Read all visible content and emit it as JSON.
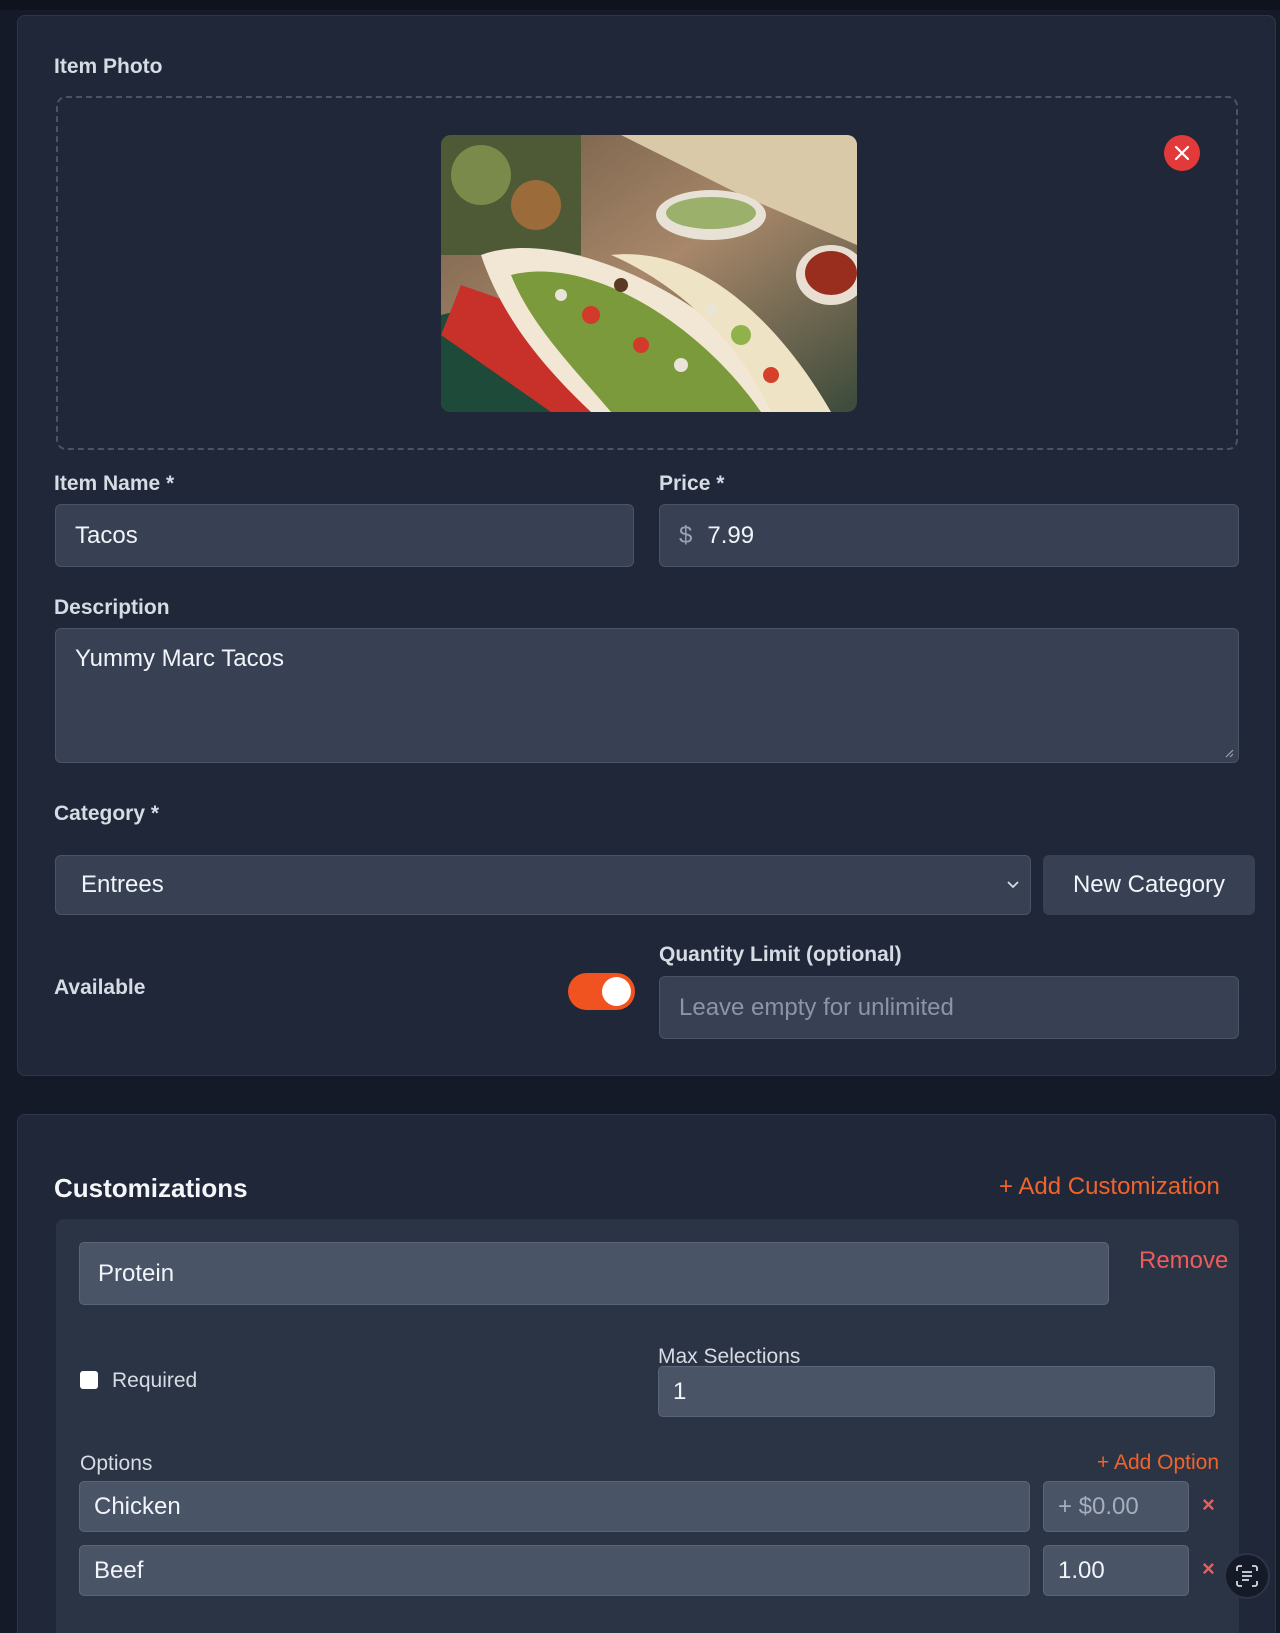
{
  "item_photo": {
    "label": "Item Photo",
    "remove_icon": "close-icon"
  },
  "item_name": {
    "label": "Item Name *",
    "value": "Tacos"
  },
  "price": {
    "label": "Price *",
    "currency": "$",
    "value": "7.99"
  },
  "description": {
    "label": "Description",
    "value": "Yummy Marc Tacos"
  },
  "category": {
    "label": "Category *",
    "selected": "Entrees",
    "new_button": "New Category"
  },
  "available": {
    "label": "Available",
    "on": true
  },
  "quantity_limit": {
    "label": "Quantity Limit (optional)",
    "placeholder": "Leave empty for unlimited",
    "value": ""
  },
  "customizations": {
    "title": "Customizations",
    "add_label": "+ Add Customization",
    "groups": [
      {
        "name": "Protein",
        "remove_label": "Remove",
        "required_label": "Required",
        "required": false,
        "max_selections_label": "Max Selections",
        "max_selections": "1",
        "options_label": "Options",
        "add_option_label": "+ Add Option",
        "options": [
          {
            "name": "Chicken",
            "price": "",
            "price_placeholder": "+ $0.00",
            "remove": "×"
          },
          {
            "name": "Beef",
            "price": "1.00",
            "price_placeholder": "+ $0.00",
            "remove": "×"
          }
        ]
      }
    ]
  },
  "colors": {
    "accent": "#f0531f",
    "danger": "#e23a3a",
    "card_bg": "#1f2738",
    "input_bg": "#374153"
  }
}
